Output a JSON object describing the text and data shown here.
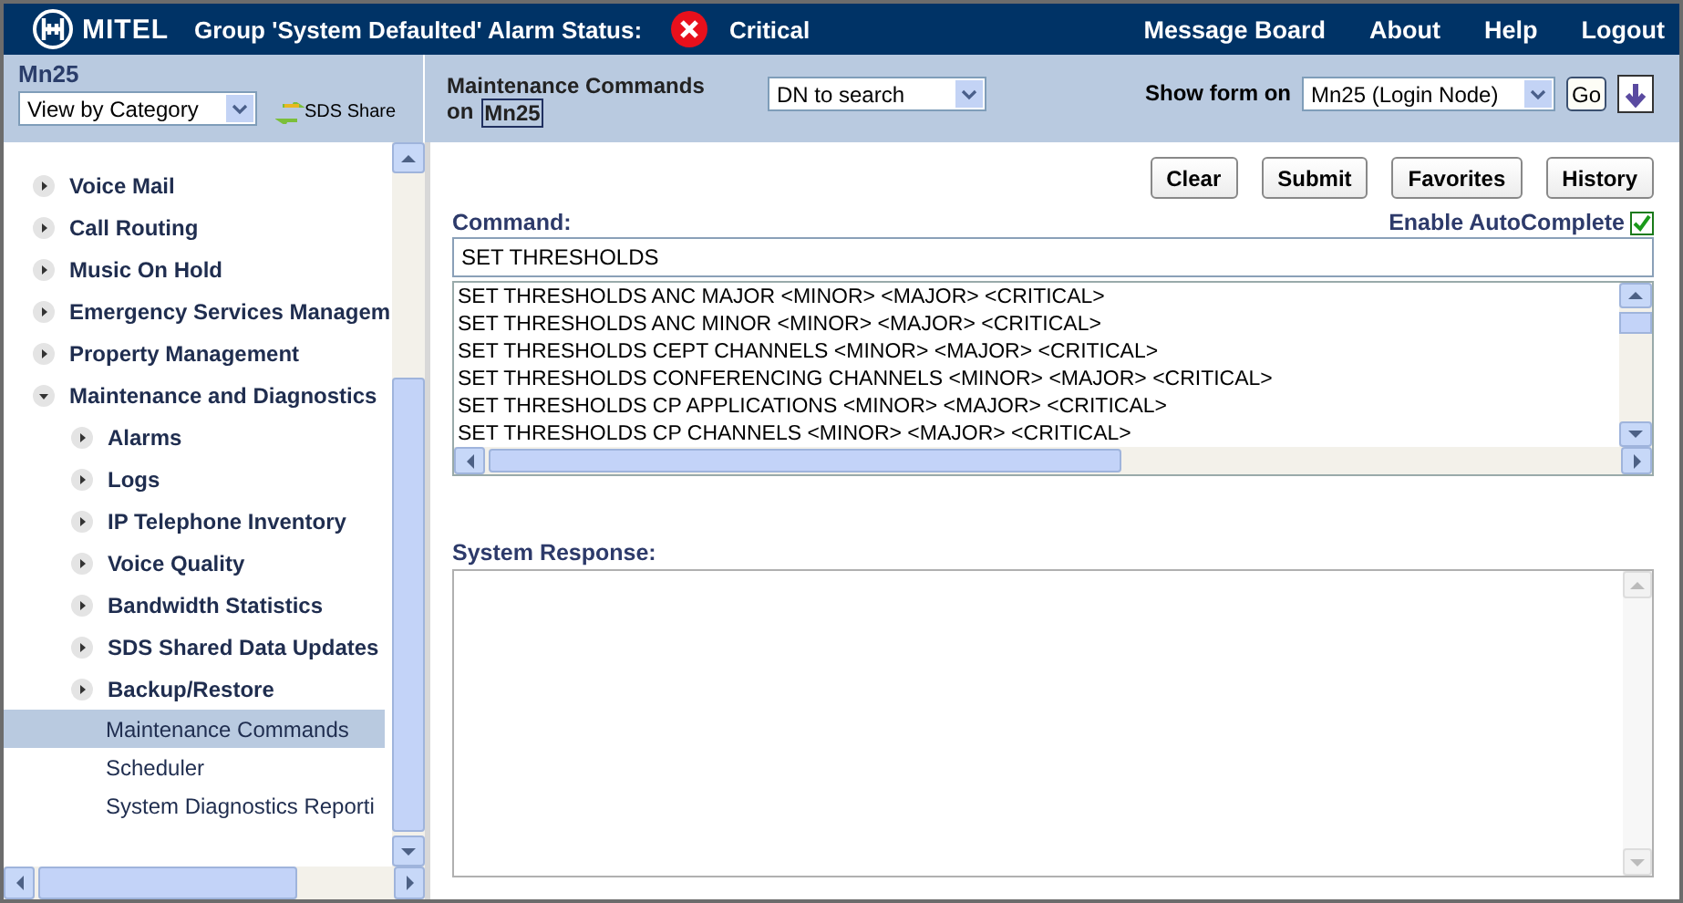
{
  "header": {
    "logo": "MITEL",
    "alarm_label": "Group 'System Defaulted' Alarm Status:",
    "alarm_status": "Critical",
    "links": [
      "Message Board",
      "About",
      "Help",
      "Logout"
    ]
  },
  "subheader": {
    "node": "Mn25",
    "view_select": "View by Category",
    "sds_share": "SDS Share",
    "form_title": "Maintenance Commands",
    "form_on": "on",
    "form_node": "Mn25",
    "dn_select": "DN to search",
    "show_form_label": "Show form on",
    "show_form_select": "Mn25 (Login Node)",
    "go": "Go"
  },
  "sidebar": {
    "items": [
      {
        "label": "Voice Mail",
        "kind": "folder",
        "expanded": false,
        "selected": false
      },
      {
        "label": "Call Routing",
        "kind": "folder",
        "expanded": false,
        "selected": false
      },
      {
        "label": "Music On Hold",
        "kind": "folder",
        "expanded": false,
        "selected": false
      },
      {
        "label": "Emergency Services Managem",
        "kind": "folder",
        "expanded": false,
        "selected": false
      },
      {
        "label": "Property Management",
        "kind": "folder",
        "expanded": false,
        "selected": false
      },
      {
        "label": "Maintenance and Diagnostics",
        "kind": "folder",
        "expanded": true,
        "selected": false,
        "children": [
          {
            "label": "Alarms",
            "kind": "folder",
            "expanded": false,
            "selected": false
          },
          {
            "label": "Logs",
            "kind": "folder",
            "expanded": false,
            "selected": false
          },
          {
            "label": "IP Telephone Inventory",
            "kind": "folder",
            "expanded": false,
            "selected": false
          },
          {
            "label": "Voice Quality",
            "kind": "folder",
            "expanded": false,
            "selected": false
          },
          {
            "label": "Bandwidth Statistics",
            "kind": "folder",
            "expanded": false,
            "selected": false
          },
          {
            "label": "SDS Shared Data Updates",
            "kind": "folder",
            "expanded": false,
            "selected": false
          },
          {
            "label": "Backup/Restore",
            "kind": "folder",
            "expanded": false,
            "selected": false
          },
          {
            "label": "Maintenance Commands",
            "kind": "leaf",
            "selected": true
          },
          {
            "label": "Scheduler",
            "kind": "leaf",
            "selected": false
          },
          {
            "label": "System Diagnostics Reporti",
            "kind": "leaf",
            "selected": false
          }
        ]
      }
    ]
  },
  "buttons": [
    "Clear",
    "Submit",
    "Favorites",
    "History"
  ],
  "command": {
    "label": "Command:",
    "autocomplete_label": "Enable AutoComplete",
    "autocomplete_checked": true,
    "value": "SET THRESHOLDS",
    "suggestions": [
      "SET THRESHOLDS ANC MAJOR <MINOR> <MAJOR> <CRITICAL>",
      "SET THRESHOLDS ANC MINOR <MINOR> <MAJOR> <CRITICAL>",
      "SET THRESHOLDS CEPT CHANNELS <MINOR> <MAJOR> <CRITICAL>",
      "SET THRESHOLDS CONFERENCING CHANNELS <MINOR> <MAJOR> <CRITICAL>",
      "SET THRESHOLDS CP APPLICATIONS <MINOR> <MAJOR> <CRITICAL>",
      "SET THRESHOLDS CP CHANNELS <MINOR> <MAJOR> <CRITICAL>"
    ]
  },
  "response": {
    "label": "System Response:"
  }
}
